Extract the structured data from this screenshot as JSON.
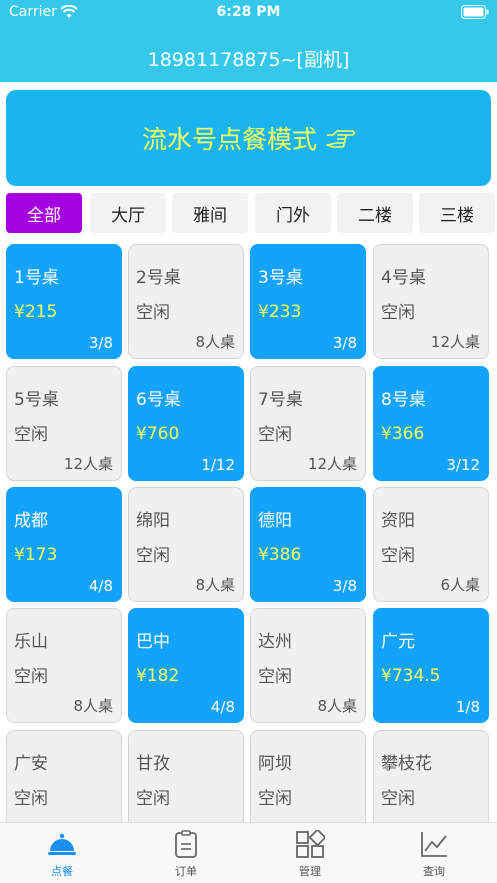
{
  "status_bar": {
    "carrier": "Carrier",
    "time": "6:28 PM"
  },
  "header": {
    "title": "18981178875~[副机]"
  },
  "banner": {
    "text": "流水号点餐模式",
    "icon": "pointing-hand-icon",
    "text_color": "#f6ff5c",
    "bg_color": "#1ab4f0"
  },
  "tabs": [
    {
      "label": "全部",
      "active": true
    },
    {
      "label": "大厅",
      "active": false
    },
    {
      "label": "雅间",
      "active": false
    },
    {
      "label": "门外",
      "active": false
    },
    {
      "label": "二楼",
      "active": false
    },
    {
      "label": "三楼",
      "active": false
    }
  ],
  "colors": {
    "header": "#36c8ea",
    "busy_card": "#13a3fb",
    "active_tab": "#a400e0",
    "idle_card": "#f0f0f0",
    "price": "#f6ff5c"
  },
  "tables": [
    {
      "name": "1号桌",
      "status": "¥215",
      "count": "3/8",
      "busy": true
    },
    {
      "name": "2号桌",
      "status": "空闲",
      "count": "8人桌",
      "busy": false
    },
    {
      "name": "3号桌",
      "status": "¥233",
      "count": "3/8",
      "busy": true
    },
    {
      "name": "4号桌",
      "status": "空闲",
      "count": "12人桌",
      "busy": false
    },
    {
      "name": "5号桌",
      "status": "空闲",
      "count": "12人桌",
      "busy": false
    },
    {
      "name": "6号桌",
      "status": "¥760",
      "count": "1/12",
      "busy": true
    },
    {
      "name": "7号桌",
      "status": "空闲",
      "count": "12人桌",
      "busy": false
    },
    {
      "name": "8号桌",
      "status": "¥366",
      "count": "3/12",
      "busy": true
    },
    {
      "name": "成都",
      "status": "¥173",
      "count": "4/8",
      "busy": true
    },
    {
      "name": "绵阳",
      "status": "空闲",
      "count": "8人桌",
      "busy": false
    },
    {
      "name": "德阳",
      "status": "¥386",
      "count": "3/8",
      "busy": true
    },
    {
      "name": "资阳",
      "status": "空闲",
      "count": "6人桌",
      "busy": false
    },
    {
      "name": "乐山",
      "status": "空闲",
      "count": "8人桌",
      "busy": false
    },
    {
      "name": "巴中",
      "status": "¥182",
      "count": "4/8",
      "busy": true
    },
    {
      "name": "达州",
      "status": "空闲",
      "count": "8人桌",
      "busy": false
    },
    {
      "name": "广元",
      "status": "¥734.5",
      "count": "1/8",
      "busy": true
    },
    {
      "name": "广安",
      "status": "空闲",
      "count": "",
      "busy": false
    },
    {
      "name": "甘孜",
      "status": "空闲",
      "count": "",
      "busy": false
    },
    {
      "name": "阿坝",
      "status": "空闲",
      "count": "",
      "busy": false
    },
    {
      "name": "攀枝花",
      "status": "空闲",
      "count": "",
      "busy": false
    }
  ],
  "tabbar": [
    {
      "label": "点餐",
      "icon": "cloche-icon",
      "active": true
    },
    {
      "label": "订单",
      "icon": "clipboard-icon",
      "active": false
    },
    {
      "label": "管理",
      "icon": "grid-icon",
      "active": false
    },
    {
      "label": "查询",
      "icon": "chart-icon",
      "active": false
    }
  ]
}
